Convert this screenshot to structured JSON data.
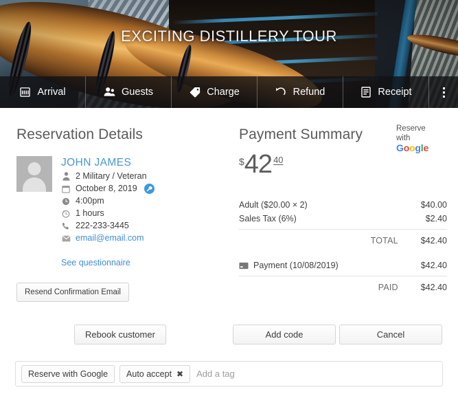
{
  "hero": {
    "title": "EXCITING DISTILLERY TOUR"
  },
  "toolbar": {
    "items": [
      {
        "label": "Arrival",
        "icon": "calendar-icon"
      },
      {
        "label": "Guests",
        "icon": "people-icon"
      },
      {
        "label": "Charge",
        "icon": "tag-icon"
      },
      {
        "label": "Refund",
        "icon": "undo-arrow-icon"
      },
      {
        "label": "Receipt",
        "icon": "receipt-icon"
      }
    ],
    "more_label": "More options"
  },
  "reservation": {
    "section_title": "Reservation Details",
    "customer_name": "JOHN JAMES",
    "details": [
      {
        "icon": "person-icon",
        "text": "2 Military / Veteran"
      },
      {
        "icon": "calendar-icon",
        "text": "October 8, 2019",
        "badge": "reserve-with-google-badge"
      },
      {
        "icon": "clock-icon",
        "text": "4:00pm"
      },
      {
        "icon": "duration-icon",
        "text": "1 hours"
      },
      {
        "icon": "phone-icon",
        "text": "222-233-3445"
      },
      {
        "icon": "envelope-icon",
        "text": "email@email.com",
        "is_link": true
      }
    ],
    "questionnaire_link": "See questionnaire",
    "resend_button": "Resend Confirmation Email"
  },
  "payment": {
    "section_title": "Payment Summary",
    "reserve_with": {
      "line1": "Reserve",
      "line2": "with",
      "google": "Google"
    },
    "total_display": {
      "currency": "$",
      "whole": "42",
      "cents": "40"
    },
    "line_items": [
      {
        "label": "Adult ($20.00 × 2)",
        "amount": "$40.00"
      },
      {
        "label": "Sales Tax (6%)",
        "amount": "$2.40"
      }
    ],
    "total_row": {
      "key": "TOTAL",
      "amount": "$42.40"
    },
    "payment_row": {
      "label": "Payment (10/08/2019)",
      "amount": "$42.40",
      "icon": "credit-card-icon"
    },
    "paid_row": {
      "key": "PAID",
      "amount": "$42.40"
    }
  },
  "actions": {
    "rebook": "Rebook customer",
    "add_code": "Add code",
    "cancel": "Cancel"
  },
  "tags": {
    "items": [
      {
        "label": "Reserve with Google",
        "removable": false
      },
      {
        "label": "Auto accept",
        "removable": true,
        "remove_glyph": "✖"
      }
    ],
    "placeholder": "Add a tag",
    "value": ""
  },
  "colors": {
    "link": "#3f8fd0",
    "customer_name": "#4a96d2",
    "badge_blue": "#3a9ae0",
    "google_blue": "#4285f4",
    "google_red": "#ea4335",
    "google_yellow": "#fbbc05",
    "google_green": "#34a853"
  }
}
